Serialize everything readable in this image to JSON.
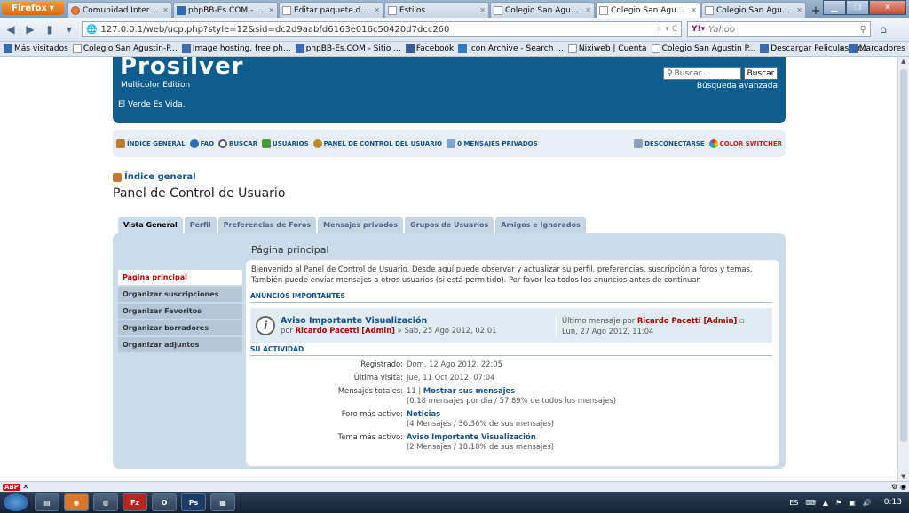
{
  "browser": {
    "menu_label": "Firefox",
    "tabs": [
      {
        "title": "Comunidad Interfor...",
        "active": false
      },
      {
        "title": "phpBB-Es.COM - Sit...",
        "active": false
      },
      {
        "title": "Editar paquete de i...",
        "active": false
      },
      {
        "title": "Estilos",
        "active": false
      },
      {
        "title": "Colegio San Agusti...",
        "active": false
      },
      {
        "title": "Colegio San Agusti...",
        "active": true
      },
      {
        "title": "Colegio San Agusti...",
        "active": false
      }
    ],
    "new_tab": "+",
    "url": "127.0.0.1/web/ucp.php?style=12&sid=dc2d9aabfd6163e016c50420d7dcc260",
    "url_suffix": "☆ ▾ C",
    "search_engine": "Yahoo",
    "search_placeholder": "Yahoo",
    "bookmarks": [
      "Más visitados",
      "Colegio San Agustin-P...",
      "Image hosting, free ph...",
      "phpBB-Es.COM - Sitio ...",
      "Facebook",
      "Icon Archive - Search ...",
      "Nixiweb | Cuenta",
      "Colegio San Agustin P...",
      "Descargar Peliculas Gr..."
    ],
    "bookmarks_more": "»",
    "bookmarks_menu": "Marcadores"
  },
  "site": {
    "logo": "Prosilver",
    "logo_sub": "Multicolor Edition",
    "tagline": "El Verde Es Vida.",
    "search_placeholder": "Buscar...",
    "search_button": "Buscar",
    "advanced_search": "Búsqueda avanzada"
  },
  "nav": {
    "left": [
      {
        "label": "ÍNDICE GENERAL",
        "icon": "home-icon"
      },
      {
        "label": "FAQ",
        "icon": "faq-icon"
      },
      {
        "label": "BUSCAR",
        "icon": "search-icon"
      },
      {
        "label": "USUARIOS",
        "icon": "users-icon"
      },
      {
        "label": "PANEL DE CONTROL DEL USUARIO",
        "icon": "ucp-icon"
      },
      {
        "label": "0 MENSAJES PRIVADOS",
        "icon": "pm-icon"
      }
    ],
    "logout": "DESCONECTARSE",
    "colorswitcher": "COLOR SWITCHER"
  },
  "breadcrumb": "Índice general",
  "page_title": "Panel de Control de Usuario",
  "ucp_tabs": [
    "Vista General",
    "Perfil",
    "Preferencias de Foros",
    "Mensajes privados",
    "Grupos de Usuarios",
    "Amigos e Ignorados"
  ],
  "side_menu": [
    "Página principal",
    "Organizar suscripciones",
    "Organizar Favoritos",
    "Organizar borradores",
    "Organizar adjuntos"
  ],
  "main": {
    "title": "Página principal",
    "intro": "Bienvenido al Panel de Control de Usuario. Desde aquí puede observar y actualizar su perfil, preferencias, suscripción a foros y temas. También puede enviar mensajes a otros usuarios (si está permitido). Por favor lea todos los anuncios antes de continuar.",
    "announcements_header": "ANUNCIOS IMPORTANTES",
    "announcement": {
      "title": "Aviso Importante Visualización",
      "by_prefix": "por",
      "author": "Ricardo Pacetti [Admin]",
      "date": "» Sab, 25 Ago 2012, 02:01",
      "last_prefix": "Último mensaje por",
      "last_author": "Ricardo Pacetti [Admin]",
      "last_date": "Lun, 27 Ago 2012, 11:04"
    },
    "activity_header": "SU ACTIVIDAD",
    "stats": {
      "registered_label": "Registrado:",
      "registered": "Dom, 12 Ago 2012, 22:05",
      "last_visit_label": "Última visita:",
      "last_visit": "Jue, 11 Oct 2012, 07:04",
      "posts_label": "Mensajes totales:",
      "posts_count": "11",
      "posts_sep": "|",
      "posts_link": "Mostrar sus mensajes",
      "posts_detail": "(0.18 mensajes por dia / 57.89% de todos los mensajes)",
      "forum_label": "Foro más activo:",
      "forum": "Noticias",
      "forum_detail": "(4 Mensajes / 36.36% de sus mensajes)",
      "topic_label": "Tema más activo:",
      "topic": "Aviso Importante Visualización",
      "topic_detail": "(2 Mensajes / 18.18% de sus mensajes)"
    }
  },
  "taskbar": {
    "lang": "ES",
    "time": "0:13"
  }
}
